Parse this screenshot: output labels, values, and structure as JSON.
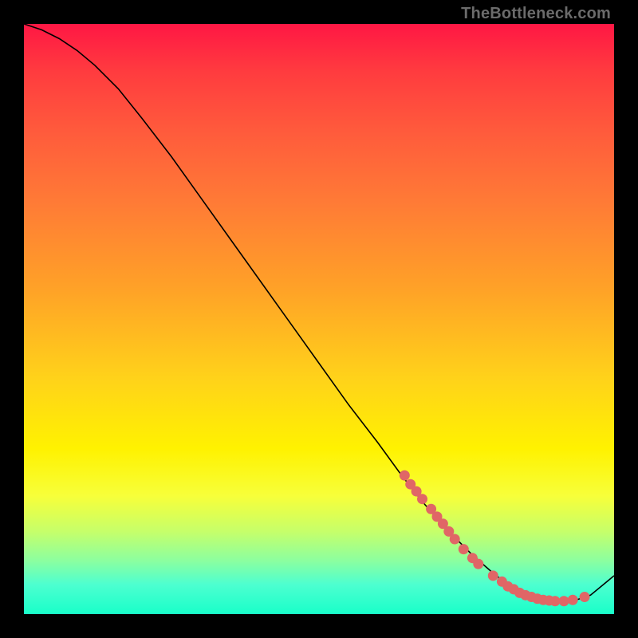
{
  "watermark": "TheBottleneck.com",
  "colors": {
    "point": "#e06666",
    "curve": "#000000",
    "gradient_top": "#ff1744",
    "gradient_bottom": "#19ffc9"
  },
  "chart_data": {
    "type": "line",
    "title": "",
    "xlabel": "",
    "ylabel": "",
    "xlim": [
      0,
      100
    ],
    "ylim": [
      0,
      100
    ],
    "grid": false,
    "legend": false,
    "series": [
      {
        "name": "bottleneck-curve",
        "x": [
          0,
          3,
          6,
          9,
          12,
          16,
          20,
          25,
          30,
          35,
          40,
          45,
          50,
          55,
          60,
          64,
          68,
          72,
          76,
          80,
          84,
          87,
          90,
          93,
          96,
          100
        ],
        "y": [
          100,
          99,
          97.5,
          95.5,
          93,
          89,
          84,
          77.5,
          70.5,
          63.5,
          56.5,
          49.5,
          42.5,
          35.5,
          29,
          23.5,
          18.5,
          14,
          10,
          6.5,
          4,
          2.8,
          2.2,
          2.2,
          3.2,
          6.5
        ]
      }
    ],
    "points": [
      {
        "x": 64.5,
        "y": 23.5
      },
      {
        "x": 65.5,
        "y": 22.0
      },
      {
        "x": 66.5,
        "y": 20.8
      },
      {
        "x": 67.5,
        "y": 19.5
      },
      {
        "x": 69.0,
        "y": 17.8
      },
      {
        "x": 70.0,
        "y": 16.5
      },
      {
        "x": 71.0,
        "y": 15.3
      },
      {
        "x": 72.0,
        "y": 14.0
      },
      {
        "x": 73.0,
        "y": 12.7
      },
      {
        "x": 74.5,
        "y": 11.0
      },
      {
        "x": 76.0,
        "y": 9.5
      },
      {
        "x": 77.0,
        "y": 8.5
      },
      {
        "x": 79.5,
        "y": 6.5
      },
      {
        "x": 81.0,
        "y": 5.5
      },
      {
        "x": 82.0,
        "y": 4.7
      },
      {
        "x": 83.0,
        "y": 4.2
      },
      {
        "x": 84.0,
        "y": 3.6
      },
      {
        "x": 85.0,
        "y": 3.2
      },
      {
        "x": 86.0,
        "y": 2.9
      },
      {
        "x": 87.0,
        "y": 2.6
      },
      {
        "x": 88.0,
        "y": 2.4
      },
      {
        "x": 89.0,
        "y": 2.3
      },
      {
        "x": 90.0,
        "y": 2.2
      },
      {
        "x": 91.5,
        "y": 2.2
      },
      {
        "x": 93.0,
        "y": 2.4
      },
      {
        "x": 95.0,
        "y": 2.9
      }
    ]
  }
}
